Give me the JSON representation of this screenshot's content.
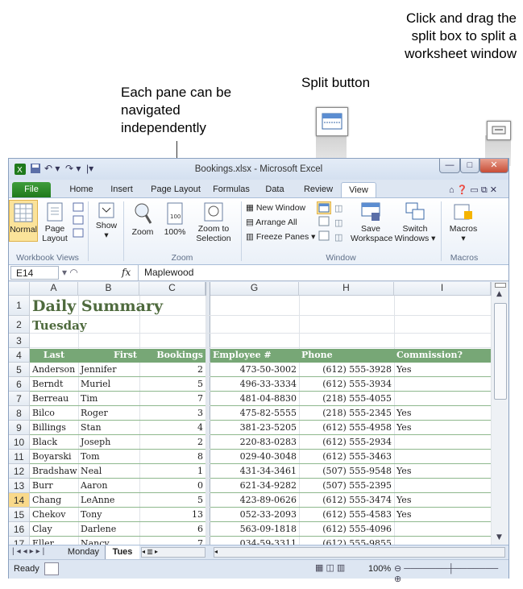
{
  "callouts": {
    "panes": "Each pane can be navigated independently",
    "split_button": "Split button",
    "split_box": "Click and drag the split box to split a worksheet window"
  },
  "window": {
    "title": "Bookings.xlsx - Microsoft Excel",
    "controls": {
      "minimize": "—",
      "maximize": "□",
      "close": "✕"
    }
  },
  "tabs": [
    "File",
    "Home",
    "Insert",
    "Page Layout",
    "Formulas",
    "Data",
    "Review",
    "View"
  ],
  "active_tab": "View",
  "ribbon": {
    "workbook_views": {
      "label": "Workbook Views",
      "normal": "Normal",
      "page_layout": "Page Layout"
    },
    "show": "Show",
    "zoom_group": {
      "label": "Zoom",
      "zoom": "Zoom",
      "pct100": "100%",
      "zoom_sel": "Zoom to Selection"
    },
    "window_group": {
      "label": "Window",
      "new_window": "New Window",
      "arrange_all": "Arrange All",
      "freeze": "Freeze Panes",
      "save_ws": "Save Workspace",
      "switch": "Switch Windows"
    },
    "macros_group": {
      "label": "Macros",
      "macros": "Macros"
    }
  },
  "formula_bar": {
    "name_box": "E14",
    "fx": "fx",
    "value": "Maplewood"
  },
  "columns_left": [
    "A",
    "B",
    "C"
  ],
  "columns_right": [
    "G",
    "H",
    "I"
  ],
  "rows": [
    "1",
    "2",
    "3",
    "4",
    "5",
    "6",
    "7",
    "8",
    "9",
    "10",
    "11",
    "12",
    "13",
    "14",
    "15",
    "16",
    "17"
  ],
  "title_cell": "Daily Summary",
  "subtitle_cell": "Tuesday",
  "headers_left": [
    "Last",
    "First",
    "Bookings"
  ],
  "headers_right": [
    "Employee #",
    "Phone",
    "Commission?"
  ],
  "data": [
    [
      "Anderson",
      "Jennifer",
      "2",
      "473-50-3002",
      "(612) 555-3928",
      "Yes"
    ],
    [
      "Berndt",
      "Muriel",
      "5",
      "496-33-3334",
      "(612) 555-3934",
      ""
    ],
    [
      "Berreau",
      "Tim",
      "7",
      "481-04-8830",
      "(218) 555-4055",
      ""
    ],
    [
      "Bilco",
      "Roger",
      "3",
      "475-82-5555",
      "(218) 555-2345",
      "Yes"
    ],
    [
      "Billings",
      "Stan",
      "4",
      "381-23-5205",
      "(612) 555-4958",
      "Yes"
    ],
    [
      "Black",
      "Joseph",
      "2",
      "220-83-0283",
      "(612) 555-2934",
      ""
    ],
    [
      "Boyarski",
      "Tom",
      "8",
      "029-40-3048",
      "(612) 555-3463",
      ""
    ],
    [
      "Bradshaw",
      "Neal",
      "1",
      "431-34-3461",
      "(507) 555-9548",
      "Yes"
    ],
    [
      "Burr",
      "Aaron",
      "0",
      "621-34-9282",
      "(507) 555-2395",
      ""
    ],
    [
      "Chang",
      "LeAnne",
      "5",
      "423-89-0626",
      "(612) 555-3474",
      "Yes"
    ],
    [
      "Chekov",
      "Tony",
      "13",
      "052-33-2093",
      "(612) 555-4583",
      "Yes"
    ],
    [
      "Clay",
      "Darlene",
      "6",
      "563-09-1818",
      "(612) 555-4096",
      ""
    ],
    [
      "Eller",
      "Nancy",
      "7",
      "034-59-3311",
      "(612) 555-9855",
      ""
    ]
  ],
  "sheets": [
    "Monday",
    "Tues"
  ],
  "status": {
    "ready": "Ready",
    "zoom": "100%"
  }
}
